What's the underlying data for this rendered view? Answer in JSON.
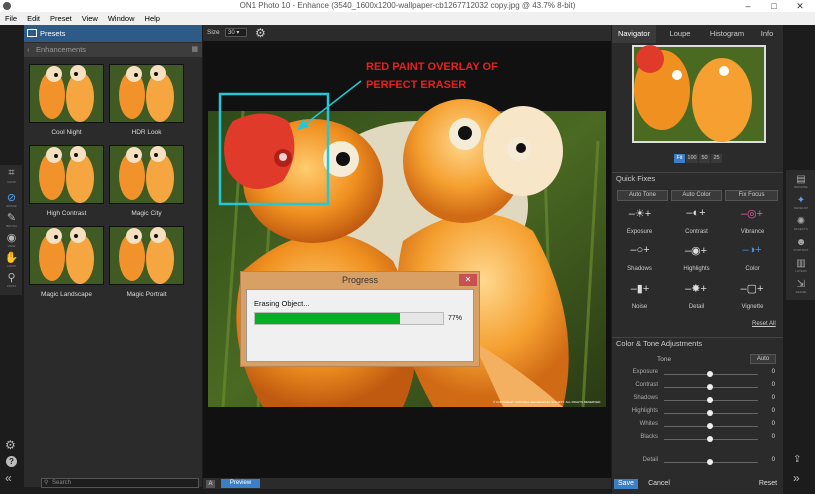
{
  "window": {
    "title": "ON1 Photo 10 - Enhance (3540_1600x1200-wallpaper-cb1267712032 copy.jpg @ 43.7% 8-bit)",
    "minimize": "–",
    "maximize": "□",
    "close": "✕"
  },
  "menu": [
    "File",
    "Edit",
    "Preset",
    "View",
    "Window",
    "Help"
  ],
  "left": {
    "presets_label": "Presets",
    "enhancements_label": "Enhancements",
    "thumbs": [
      "Cool Night",
      "HDR Look",
      "High Contrast",
      "Magic City",
      "Magic Landscape",
      "Magic Portrait"
    ],
    "tools": [
      {
        "icon": "⌗",
        "label": "CROP"
      },
      {
        "icon": "⊘",
        "label": "ERASE"
      },
      {
        "icon": "✎",
        "label": "BRUSH"
      },
      {
        "icon": "◉",
        "label": "VIEW"
      },
      {
        "icon": "✋",
        "label": "HAND"
      },
      {
        "icon": "⚲",
        "label": "ZOOM"
      }
    ],
    "search_placeholder": "Search"
  },
  "canvas": {
    "size_label": "Size",
    "size_value": "30",
    "annotation_line1": "RED PAINT OVERLAY OF",
    "annotation_line2": "PERFECT ERASER",
    "annotation_color": "#e82020",
    "box_color": "#22c8d8",
    "copyright": "© COPYRIGHT NATIONAL GEOGRAPHIC SOCIETY. ALL RIGHTS RESERVED.",
    "preview_label": "Preview",
    "preview_icon": "A"
  },
  "dialog": {
    "title": "Progress",
    "message": "Erasing Object...",
    "percent_label": "77%",
    "progress": 0.77,
    "close": "✕"
  },
  "right": {
    "tabs": [
      "Navigator",
      "Loupe",
      "Histogram",
      "Info"
    ],
    "zoom_options": [
      "Fit",
      "100",
      "50",
      "25"
    ],
    "quick_fixes_title": "Quick Fixes",
    "quick_buttons": [
      "Auto Tone",
      "Auto Color",
      "Fix Focus"
    ],
    "quick_items": [
      "Exposure",
      "Contrast",
      "Vibrance",
      "Shadows",
      "Highlights",
      "Color",
      "Noise",
      "Detail",
      "Vignette"
    ],
    "reset_all": "Reset All",
    "color_tone_title": "Color & Tone Adjustments",
    "tone_label": "Tone",
    "auto_label": "Auto",
    "sliders": [
      {
        "label": "Exposure",
        "value": "0"
      },
      {
        "label": "Contrast",
        "value": "0"
      },
      {
        "label": "Shadows",
        "value": "0"
      },
      {
        "label": "Highlights",
        "value": "0"
      },
      {
        "label": "Whites",
        "value": "0"
      },
      {
        "label": "Blacks",
        "value": "0"
      },
      {
        "label": "Detail",
        "value": "0"
      }
    ],
    "save": "Save",
    "cancel": "Cancel",
    "reset": "Reset"
  },
  "right_strip": [
    {
      "icon": "▤",
      "label": "BROWSE"
    },
    {
      "icon": "✦",
      "label": "DEVELOP"
    },
    {
      "icon": "✺",
      "label": "EFFECTS"
    },
    {
      "icon": "☻",
      "label": "PORTRAIT"
    },
    {
      "icon": "▥",
      "label": "LAYERS"
    },
    {
      "icon": "⇲",
      "label": "RESIZE"
    }
  ]
}
